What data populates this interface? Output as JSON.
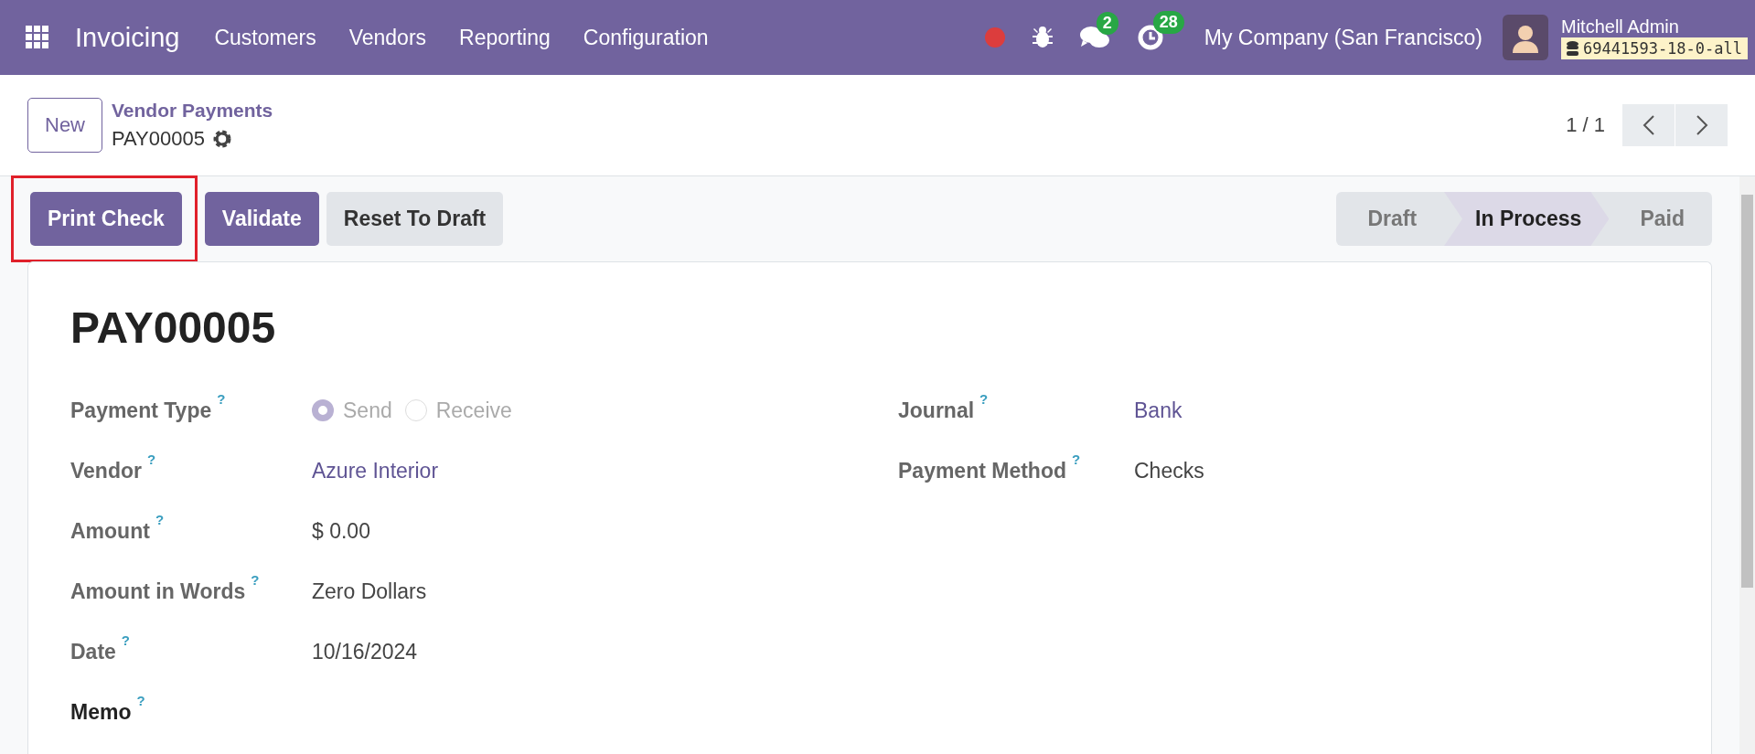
{
  "navbar": {
    "app_name": "Invoicing",
    "menu": [
      "Customers",
      "Vendors",
      "Reporting",
      "Configuration"
    ],
    "messages_count": "2",
    "activities_count": "28",
    "company": "My Company (San Francisco)",
    "user_name": "Mitchell Admin",
    "database": "69441593-18-0-all"
  },
  "control_panel": {
    "new_button": "New",
    "breadcrumb": "Vendor Payments",
    "record": "PAY00005",
    "pager": "1 / 1"
  },
  "actions": [
    {
      "label": "Print Check",
      "kind": "primary",
      "highlighted": true
    },
    {
      "label": "Validate",
      "kind": "primary",
      "highlighted": false
    },
    {
      "label": "Reset To Draft",
      "kind": "secondary",
      "highlighted": false
    }
  ],
  "status_bar": [
    {
      "label": "Draft",
      "selected": false
    },
    {
      "label": "In Process",
      "selected": true
    },
    {
      "label": "Paid",
      "selected": false
    }
  ],
  "form": {
    "title": "PAY00005",
    "left_fields": [
      {
        "label": "Payment Type",
        "kind": "radio",
        "options": [
          {
            "label": "Send",
            "selected": true
          },
          {
            "label": "Receive",
            "selected": false
          }
        ]
      },
      {
        "label": "Vendor",
        "kind": "link",
        "value": "Azure Interior"
      },
      {
        "label": "Amount",
        "kind": "text",
        "value": "$ 0.00"
      },
      {
        "label": "Amount in Words",
        "kind": "text",
        "value": "Zero Dollars"
      },
      {
        "label": "Date",
        "kind": "text",
        "value": "10/16/2024"
      },
      {
        "label": "Memo",
        "kind": "empty"
      }
    ],
    "right_fields": [
      {
        "label": "Journal",
        "kind": "link",
        "value": "Bank"
      },
      {
        "label": "Payment Method",
        "kind": "text",
        "value": "Checks"
      }
    ],
    "help_mark": "?"
  }
}
